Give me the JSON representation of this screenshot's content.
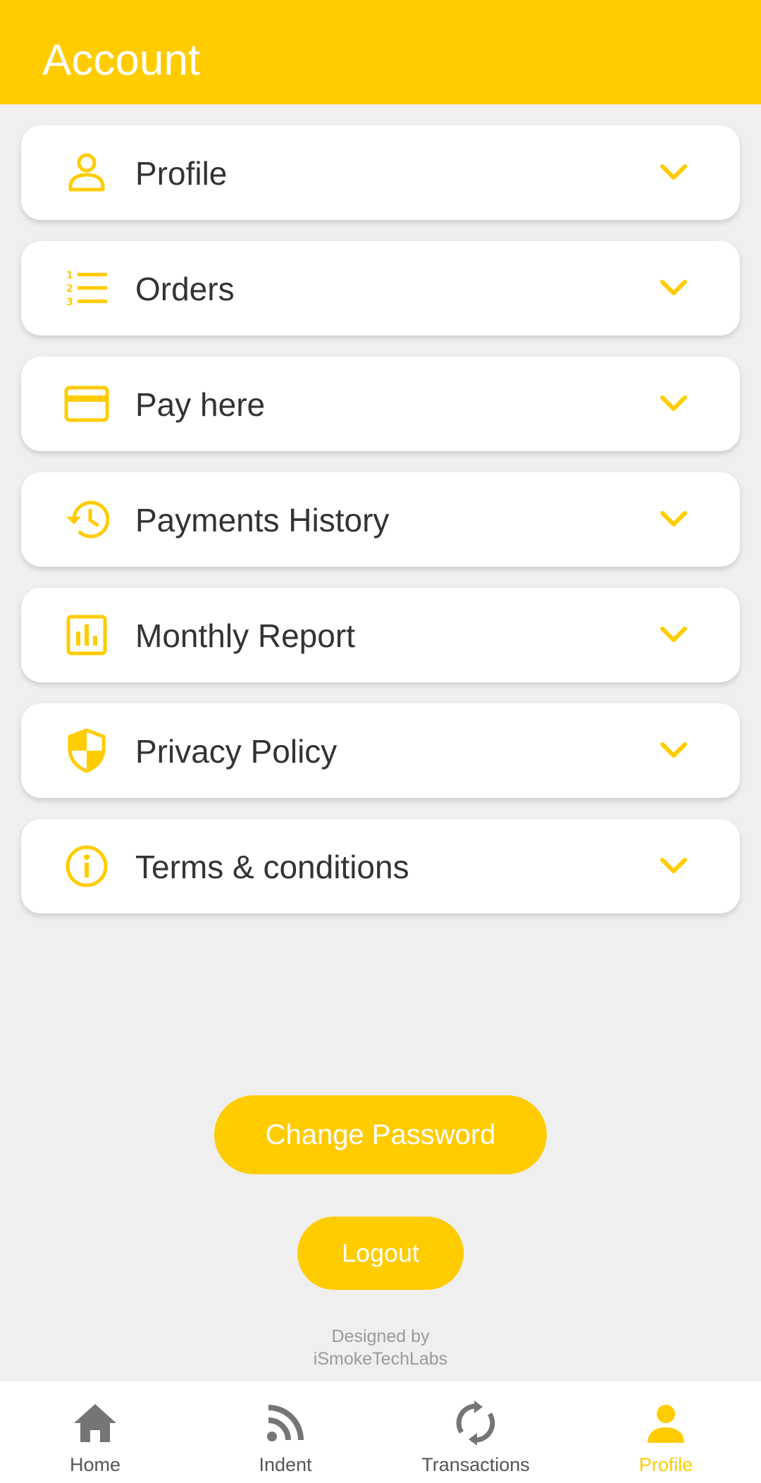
{
  "header": {
    "title": "Account"
  },
  "menu": {
    "items": [
      {
        "label": "Profile",
        "icon": "person-icon"
      },
      {
        "label": "Orders",
        "icon": "numbered-list-icon"
      },
      {
        "label": "Pay here",
        "icon": "credit-card-icon"
      },
      {
        "label": "Payments History",
        "icon": "history-icon"
      },
      {
        "label": "Monthly Report",
        "icon": "bar-chart-icon"
      },
      {
        "label": "Privacy Policy",
        "icon": "shield-icon"
      },
      {
        "label": "Terms & conditions",
        "icon": "info-icon"
      }
    ]
  },
  "actions": {
    "change_password": "Change Password",
    "logout": "Logout"
  },
  "credit": {
    "line1": "Designed by",
    "line2": "iSmokeTechLabs"
  },
  "bottom_nav": {
    "items": [
      {
        "label": "Home",
        "icon": "home-icon",
        "active": false
      },
      {
        "label": "Indent",
        "icon": "rss-icon",
        "active": false
      },
      {
        "label": "Transactions",
        "icon": "sync-icon",
        "active": false
      },
      {
        "label": "Profile",
        "icon": "person-icon",
        "active": true
      }
    ]
  },
  "colors": {
    "accent": "#FFCC00",
    "background": "#EFEFEF",
    "text": "#333333",
    "nav_inactive": "#757575"
  }
}
